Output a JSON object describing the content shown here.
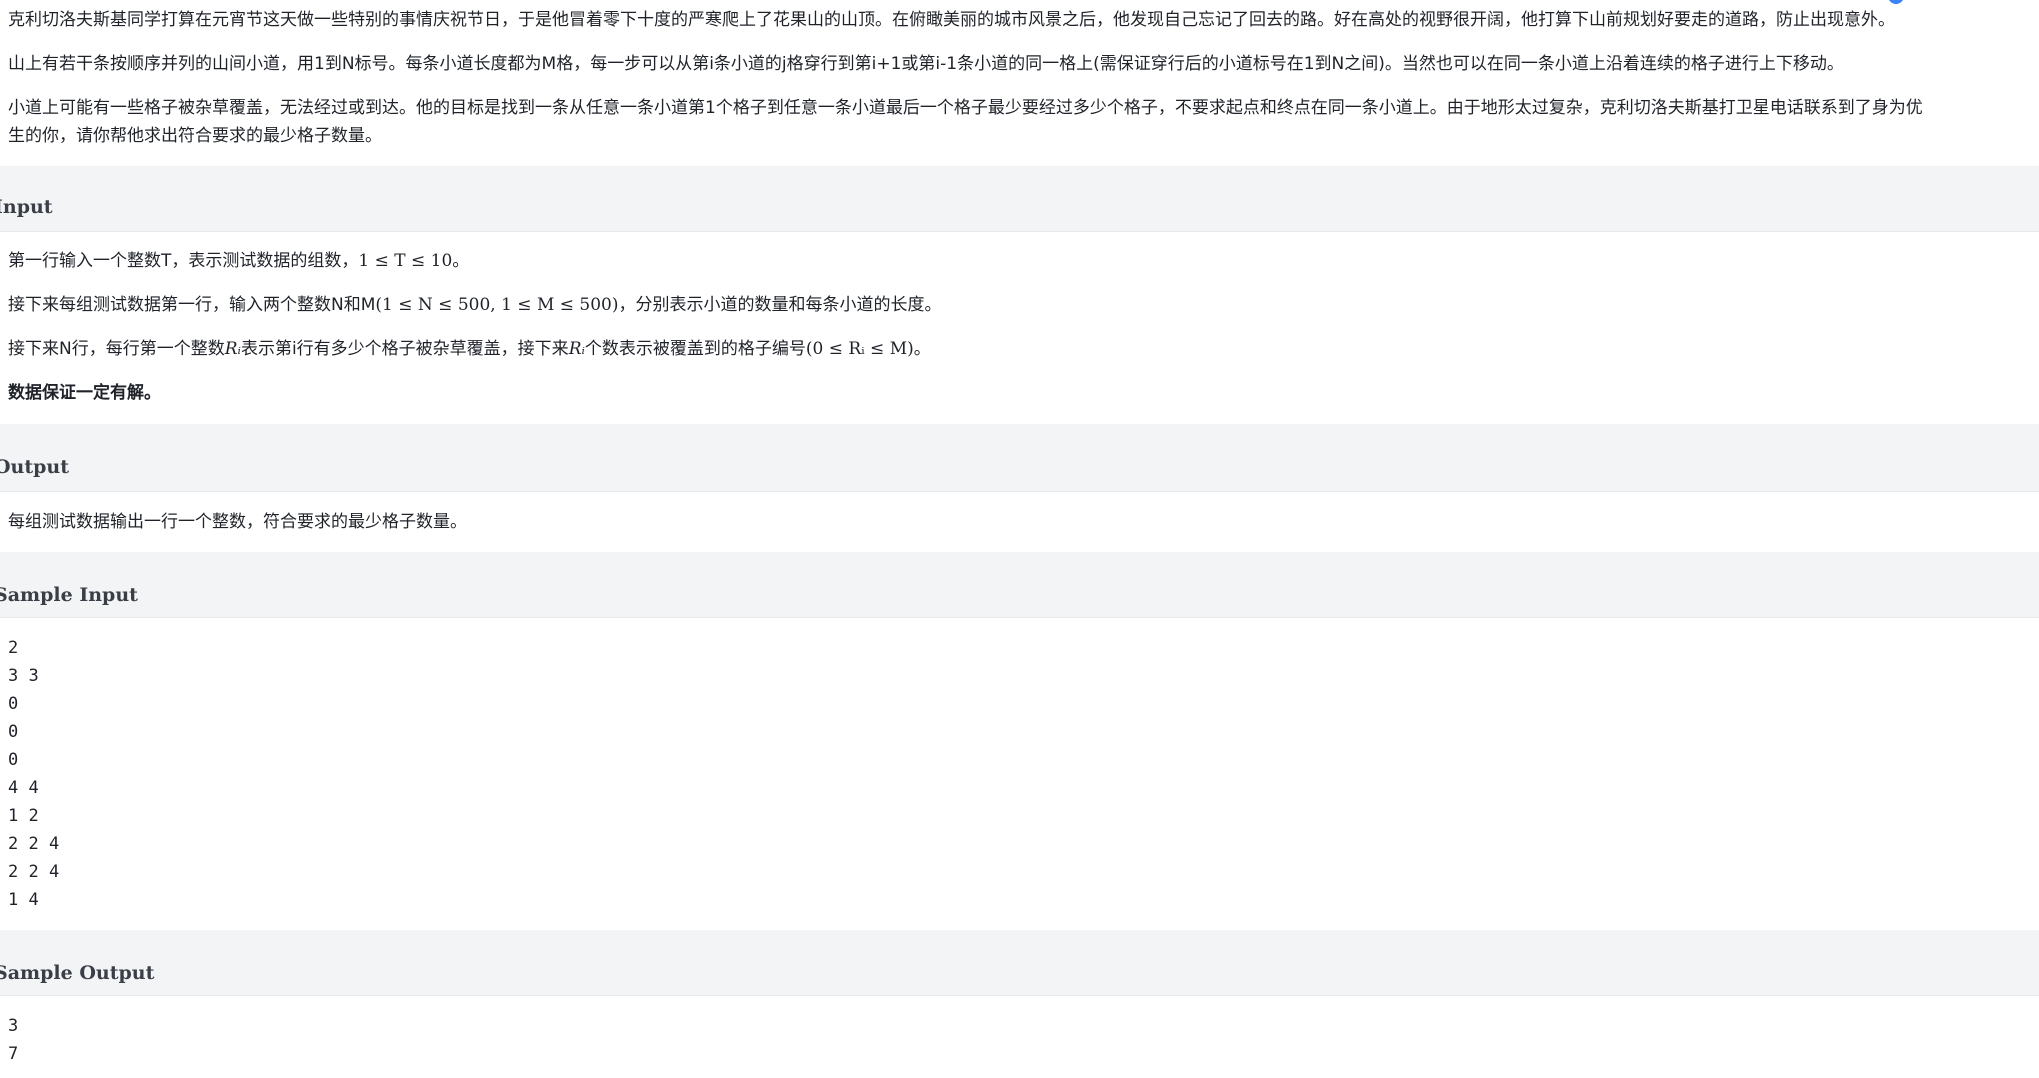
{
  "description": {
    "para1": "克利切洛夫斯基同学打算在元宵节这天做一些特别的事情庆祝节日，于是他冒着零下十度的严寒爬上了花果山的山顶。在俯瞰美丽的城市风景之后，他发现自己忘记了回去的路。好在高处的视野很开阔，他打算下山前规划好要走的道路，防止出现意外。",
    "para2": "山上有若干条按顺序并列的山间小道，用1到N标号。每条小道长度都为M格，每一步可以从第i条小道的j格穿行到第i+1或第i-1条小道的同一格上(需保证穿行后的小道标号在1到N之间)。当然也可以在同一条小道上沿着连续的格子进行上下移动。",
    "para3_line1": "小道上可能有一些格子被杂草覆盖，无法经过或到达。他的目标是找到一条从任意一条小道第1个格子到任意一条小道最后一个格子最少要经过多少个格子，不要求起点和终点在同一条小道上。由于地形太过复杂，克利切洛夫斯基打卫星电话联系到了身为优",
    "para3_line2": "生的你，请你帮他求出符合要求的最少格子数量。"
  },
  "input_section": {
    "title": "Input",
    "line1_text": "第一行输入一个整数T，表示测试数据的组数，",
    "line1_math": "1 ≤ T ≤ 10",
    "line1_end": "。",
    "line2_text": "接下来每组测试数据第一行，输入两个整数N和M",
    "line2_math": "(1 ≤ N ≤ 500, 1 ≤ M ≤ 500)",
    "line2_end": "，分别表示小道的数量和每条小道的长度。",
    "line3_text_a": "接下来N行，每行第一个整数",
    "line3_var": "Rᵢ",
    "line3_text_b": "表示第i行有多少个格子被杂草覆盖，接下来",
    "line3_text_c": "个数表示被覆盖到的格子编号",
    "line3_math": "(0 ≤ Rᵢ ≤ M)",
    "line3_end": "。",
    "note": "数据保证一定有解。"
  },
  "output_section": {
    "title": "Output",
    "text": "每组测试数据输出一行一个整数，符合要求的最少格子数量。"
  },
  "sample_input": {
    "title": "Sample Input",
    "content": "2\n3 3\n0\n0\n0\n4 4\n1 2\n2 2 4\n2 2 4\n1 4"
  },
  "sample_output": {
    "title": "Sample Output",
    "content": "3\n7"
  },
  "colors": {
    "header_bg": "#f3f4f6",
    "panel_bg": "#ffffff",
    "accent": "#3b82f6"
  }
}
